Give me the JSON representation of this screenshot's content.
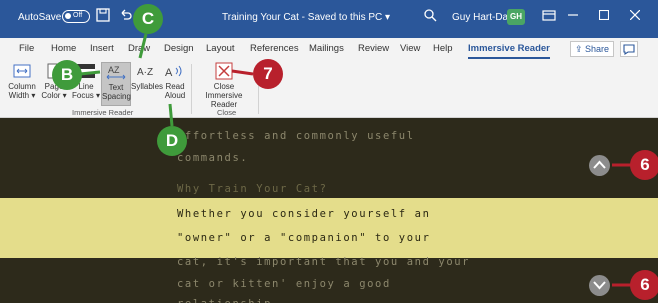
{
  "titlebar": {
    "autosave_label": "AutoSave",
    "autosave_state": "Off",
    "document_title": "Training Your Cat  -  Saved to this PC  ▾",
    "user_name": "Guy Hart-Davis",
    "user_initials": "GH"
  },
  "tabs": [
    {
      "label": "File"
    },
    {
      "label": "Home"
    },
    {
      "label": "Insert"
    },
    {
      "label": "Draw"
    },
    {
      "label": "Design"
    },
    {
      "label": "Layout"
    },
    {
      "label": "References"
    },
    {
      "label": "Mailings"
    },
    {
      "label": "Review"
    },
    {
      "label": "View"
    },
    {
      "label": "Help"
    },
    {
      "label": "Immersive Reader"
    }
  ],
  "share_label": "Share",
  "ribbon": {
    "buttons": {
      "column_width": "Column\nWidth ▾",
      "page_color": "Page\nColor ▾",
      "line_focus": "Line\nFocus ▾",
      "text_spacing": "Text\nSpacing",
      "syllables": "Syllables",
      "read_aloud": "Read\nAloud",
      "close_reader": "Close Immersive\nReader"
    },
    "groups": {
      "immersive_reader": "Immersive Reader",
      "close": "Close"
    }
  },
  "reader": {
    "lines": [
      "effortless and commonly useful",
      "commands.",
      "Why Train Your Cat?",
      "Whether you consider yourself an",
      "\"owner\" or a \"companion\" to your",
      "cat, it's important that you and your",
      "cat or kitten' enjoy a good",
      "relationship"
    ]
  },
  "callouts": {
    "c": "C",
    "b": "B",
    "d": "D",
    "seven": "7",
    "six_up": "6",
    "six_down": "6"
  },
  "colors": {
    "title_bar": "#2b579a",
    "reader_background": "#2d2a1b",
    "focus_band": "#e4dd8b",
    "callout_green": "#3f9b3b",
    "callout_red": "#b8202c"
  }
}
